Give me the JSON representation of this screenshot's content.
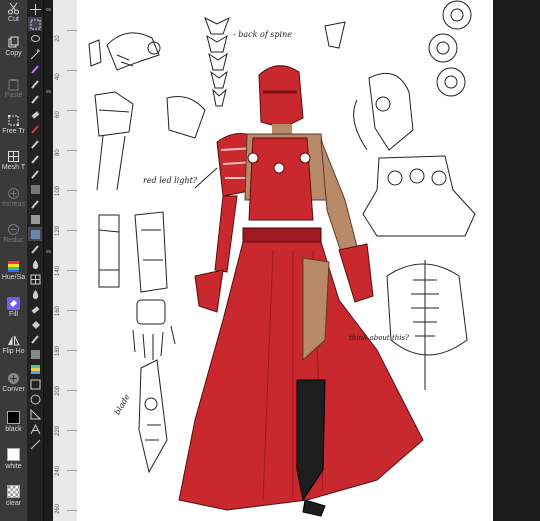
{
  "commands": [
    {
      "label": "Cut",
      "icon": "scissors-icon",
      "enabled": true
    },
    {
      "label": "Copy",
      "icon": "copy-icon",
      "enabled": true
    },
    {
      "label": "Paste",
      "icon": "paste-icon",
      "enabled": false
    },
    {
      "label": "Free Tr",
      "icon": "free-transform-icon",
      "enabled": true
    },
    {
      "label": "Mesh T",
      "icon": "mesh-transform-icon",
      "enabled": true
    },
    {
      "label": "Increas",
      "icon": "increase-icon",
      "enabled": false
    },
    {
      "label": "Reduc",
      "icon": "reduce-icon",
      "enabled": false
    },
    {
      "label": "Hue/Sa",
      "icon": "hue-saturation-icon",
      "enabled": true
    },
    {
      "label": "Fill",
      "icon": "fill-icon",
      "enabled": true
    },
    {
      "label": "Flip Ho",
      "icon": "flip-horizontal-icon",
      "enabled": true
    },
    {
      "label": "Conver",
      "icon": "convert-icon",
      "enabled": true
    },
    {
      "label": "black",
      "icon": "black-swatch",
      "enabled": true
    },
    {
      "label": "white",
      "icon": "white-swatch",
      "enabled": true
    },
    {
      "label": "clear",
      "icon": "clear-swatch",
      "enabled": true
    }
  ],
  "ruler": {
    "labels": [
      "20",
      "40",
      "60",
      "80",
      "100",
      "120",
      "140",
      "160",
      "180",
      "200",
      "220",
      "240",
      "260"
    ]
  },
  "annotations": {
    "spine": "- back of spine",
    "red_light": "red led light?",
    "think": "think about this?",
    "blade": "blade"
  },
  "colors": {
    "dress": "#c8282e",
    "dress_dark": "#9e1a20",
    "skin": "#b98a6a",
    "boot": "#1e1e1e",
    "toolbar": "#3a3a3a",
    "canvas": "#ffffff"
  }
}
